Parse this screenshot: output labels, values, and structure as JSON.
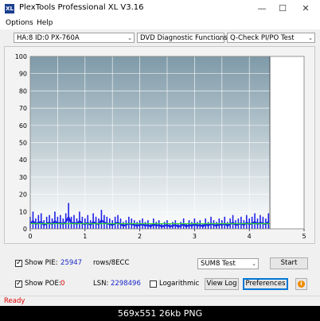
{
  "window": {
    "title": "PlexTools Professional XL V3.16",
    "app_icon": "XL",
    "minimize_glyph": "—",
    "maximize_glyph": "☐",
    "close_glyph": "✕"
  },
  "menu": {
    "items": [
      {
        "label": "Options"
      },
      {
        "label": "Help"
      }
    ]
  },
  "toolbar": {
    "drive_select": "HA:8 ID:0  PX-760A",
    "function_select": "DVD Diagnostic Functions",
    "test_select": "Q-Check PI/PO Test"
  },
  "chart_data": {
    "type": "line",
    "xlim": [
      0,
      5
    ],
    "ylim": [
      0,
      100
    ],
    "x_ticks": [
      0,
      1,
      2,
      3,
      4,
      5
    ],
    "y_ticks": [
      0,
      10,
      20,
      30,
      40,
      50,
      60,
      70,
      80,
      90,
      100
    ],
    "grid": true,
    "end_marker_x": 4.38,
    "series": [
      {
        "color": "#1e22e6",
        "kind": "spikes",
        "x": [
          0.0,
          0.05,
          0.1,
          0.15,
          0.2,
          0.25,
          0.3,
          0.35,
          0.4,
          0.45,
          0.5,
          0.55,
          0.6,
          0.65,
          0.7,
          0.75,
          0.8,
          0.85,
          0.9,
          0.95,
          1.0,
          1.05,
          1.1,
          1.15,
          1.2,
          1.25,
          1.3,
          1.35,
          1.4,
          1.45,
          1.5,
          1.55,
          1.6,
          1.65,
          1.7,
          1.75,
          1.8,
          1.85,
          1.9,
          1.95,
          2.0,
          2.05,
          2.1,
          2.15,
          2.2,
          2.25,
          2.3,
          2.35,
          2.4,
          2.45,
          2.5,
          2.55,
          2.6,
          2.65,
          2.7,
          2.75,
          2.8,
          2.85,
          2.9,
          2.95,
          3.0,
          3.05,
          3.1,
          3.15,
          3.2,
          3.25,
          3.3,
          3.35,
          3.4,
          3.45,
          3.5,
          3.55,
          3.6,
          3.65,
          3.7,
          3.75,
          3.8,
          3.85,
          3.9,
          3.95,
          4.0,
          4.05,
          4.1,
          4.15,
          4.2,
          4.25,
          4.3,
          4.35
        ],
        "y": [
          7,
          10,
          6,
          8,
          9,
          5,
          7,
          8,
          6,
          10,
          7,
          8,
          6,
          9,
          15,
          7,
          8,
          6,
          10,
          7,
          6,
          8,
          5,
          9,
          7,
          6,
          11,
          8,
          7,
          6,
          5,
          7,
          8,
          6,
          4,
          5,
          7,
          6,
          5,
          4,
          5,
          6,
          4,
          5,
          3,
          6,
          4,
          5,
          3,
          4,
          5,
          3,
          4,
          5,
          3,
          4,
          6,
          3,
          5,
          4,
          6,
          4,
          5,
          3,
          6,
          4,
          7,
          5,
          4,
          6,
          5,
          7,
          4,
          6,
          8,
          5,
          6,
          7,
          5,
          8,
          6,
          7,
          9,
          6,
          8,
          7,
          6,
          9
        ]
      },
      {
        "color": "#2fd82f",
        "kind": "baseline",
        "x": [
          0,
          1,
          2,
          3,
          4,
          4.38
        ],
        "y": [
          3,
          3,
          3,
          3,
          3,
          3
        ]
      }
    ]
  },
  "controls": {
    "show_pie_label": "Show PIE:",
    "show_pie_checked": true,
    "pie_value": "25947",
    "pie_unit": "rows/8ECC",
    "show_poe_label": "Show POE:",
    "show_poe_checked": true,
    "poe_value": "0",
    "lsn_label": "LSN:",
    "lsn_value": "2298496",
    "logarithmic_label": "Logarithmic",
    "logarithmic_checked": false,
    "sum_select": "SUM8 Test",
    "start_label": "Start",
    "view_log_label": "View Log",
    "preferences_label": "Preferences",
    "info_glyph": "i",
    "check_glyph": "✓",
    "dropdown_glyph": "⌄"
  },
  "status": {
    "text": "Ready"
  },
  "image_caption": "569x551  26kb  PNG"
}
